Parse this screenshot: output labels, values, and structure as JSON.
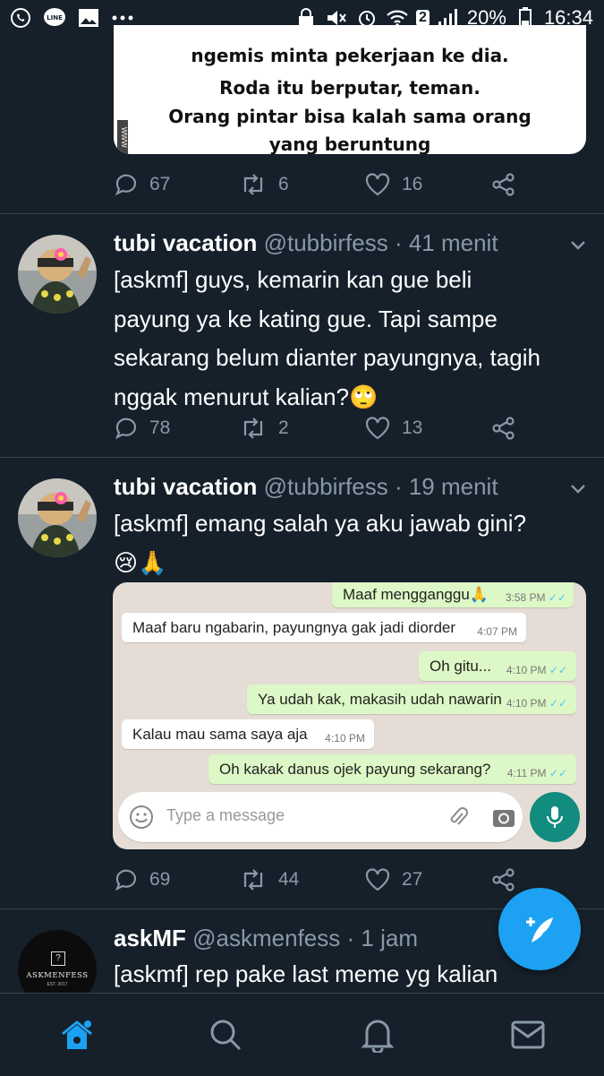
{
  "status_bar": {
    "sim_badge": "2",
    "battery": "20%",
    "time": "16:34"
  },
  "top_tweet": {
    "image_lines": [
      "ngemis minta pekerjaan ke dia.",
      "Roda itu berputar, teman.",
      "Orang pintar bisa kalah sama orang",
      "yang beruntung"
    ],
    "image_tag": "WWW",
    "replies": "67",
    "retweets": "6",
    "likes": "16"
  },
  "tweets": [
    {
      "name": "tubi vacation",
      "handle": "@tubbirfess",
      "time": "· 41 menit",
      "lines": [
        "[askmf] guys, kemarin kan gue beli",
        "payung ya ke kating gue. Tapi sampe",
        "sekarang belum dianter payungnya, tagih",
        "nggak menurut kalian?🙄"
      ],
      "replies": "78",
      "retweets": "2",
      "likes": "13"
    },
    {
      "name": "tubi vacation",
      "handle": "@tubbirfess",
      "time": "· 19 menit",
      "lines": [
        "[askmf] emang salah ya aku jawab gini?",
        "😢🙏"
      ],
      "replies": "69",
      "retweets": "44",
      "likes": "27"
    },
    {
      "name": "askMF",
      "handle": "@askmenfess",
      "time": "· 1 jam",
      "lines": [
        "[askmf] rep pake last meme yg kalian"
      ],
      "avatar_logo": "ASKMENFESS",
      "avatar_sub": "EST. 2017"
    }
  ],
  "chat": {
    "messages": [
      {
        "dir": "out",
        "text": "Maaf mengganggu🙏",
        "time": "3:58 PM",
        "ticks": "✓✓"
      },
      {
        "dir": "in",
        "text": "Maaf baru ngabarin, payungnya gak jadi diorder",
        "time": "4:07 PM"
      },
      {
        "dir": "out",
        "text": "Oh gitu...",
        "time": "4:10 PM",
        "ticks": "✓✓"
      },
      {
        "dir": "out",
        "text": "Ya udah kak, makasih udah nawarin",
        "time": "4:10 PM",
        "ticks": "✓✓"
      },
      {
        "dir": "in",
        "text": "Kalau mau sama saya aja",
        "time": "4:10 PM"
      },
      {
        "dir": "out",
        "text": "Oh kakak danus ojek payung sekarang?",
        "time": "4:11 PM",
        "ticks": "✓✓"
      }
    ],
    "input_placeholder": "Type a message"
  },
  "colors": {
    "background": "#15202b",
    "accent": "#1da1f2",
    "muted": "#8899a6",
    "divider": "#38444d"
  },
  "icons": {
    "reply": "comment-icon",
    "retweet": "retweet-icon",
    "like": "heart-icon",
    "share": "share-icon",
    "compose": "compose-tweet-icon",
    "nav": [
      "home-icon",
      "search-icon",
      "notifications-icon",
      "messages-icon"
    ]
  }
}
